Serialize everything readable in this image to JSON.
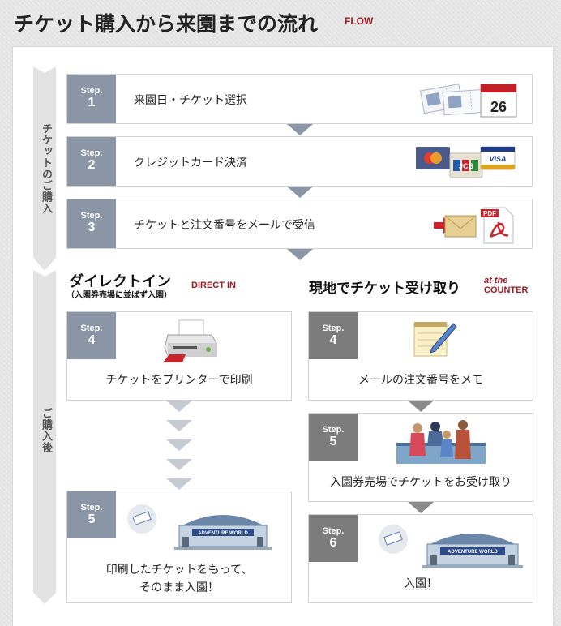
{
  "header": {
    "title": "チケット購入から来園までの流れ",
    "title_en": "FLOW"
  },
  "side": {
    "purchase_label": "チケットのご購入",
    "after_label": "ご購入後"
  },
  "purchase_steps": [
    {
      "step_label": "Step.",
      "step_num": "1",
      "text": "来園日・チケット選択",
      "icon": "tickets-calendar-icon",
      "calendar_day": "26"
    },
    {
      "step_label": "Step.",
      "step_num": "2",
      "text": "クレジットカード決済",
      "icon": "credit-cards-icon",
      "card_brands": [
        "JCB",
        "VISA"
      ]
    },
    {
      "step_label": "Step.",
      "step_num": "3",
      "text": "チケットと注文番号をメールで受信",
      "icon": "mail-pdf-icon",
      "pdf_label": "PDF"
    }
  ],
  "direct_in": {
    "title": "ダイレクトイン",
    "subtitle": "（入園券売場に並ばず入園）",
    "title_en": "DIRECT IN",
    "steps": [
      {
        "step_label": "Step.",
        "step_num": "4",
        "text": "チケットをプリンターで印刷",
        "icon": "printer-icon"
      },
      {
        "step_label": "Step.",
        "step_num": "5",
        "text_line1": "印刷したチケットをもって、",
        "text_line2": "そのまま入園！",
        "icon": "park-gate-icon",
        "gate_sign": "ADVENTURE WORLD"
      }
    ]
  },
  "counter": {
    "title": "現地でチケット受け取り",
    "title_en_line1": "at the",
    "title_en_line2": "COUNTER",
    "steps": [
      {
        "step_label": "Step.",
        "step_num": "4",
        "text": "メールの注文番号をメモ",
        "icon": "notepad-pencil-icon"
      },
      {
        "step_label": "Step.",
        "step_num": "5",
        "text": "入園券売場でチケットをお受け取り",
        "icon": "ticket-counter-icon"
      },
      {
        "step_label": "Step.",
        "step_num": "6",
        "text": "入園！",
        "icon": "park-gate-icon",
        "gate_sign": "ADVENTURE WORLD"
      }
    ]
  },
  "colors": {
    "accent_red": "#9a1a22",
    "step_blue": "#8a95a6",
    "step_grey": "#7c7c7c"
  }
}
